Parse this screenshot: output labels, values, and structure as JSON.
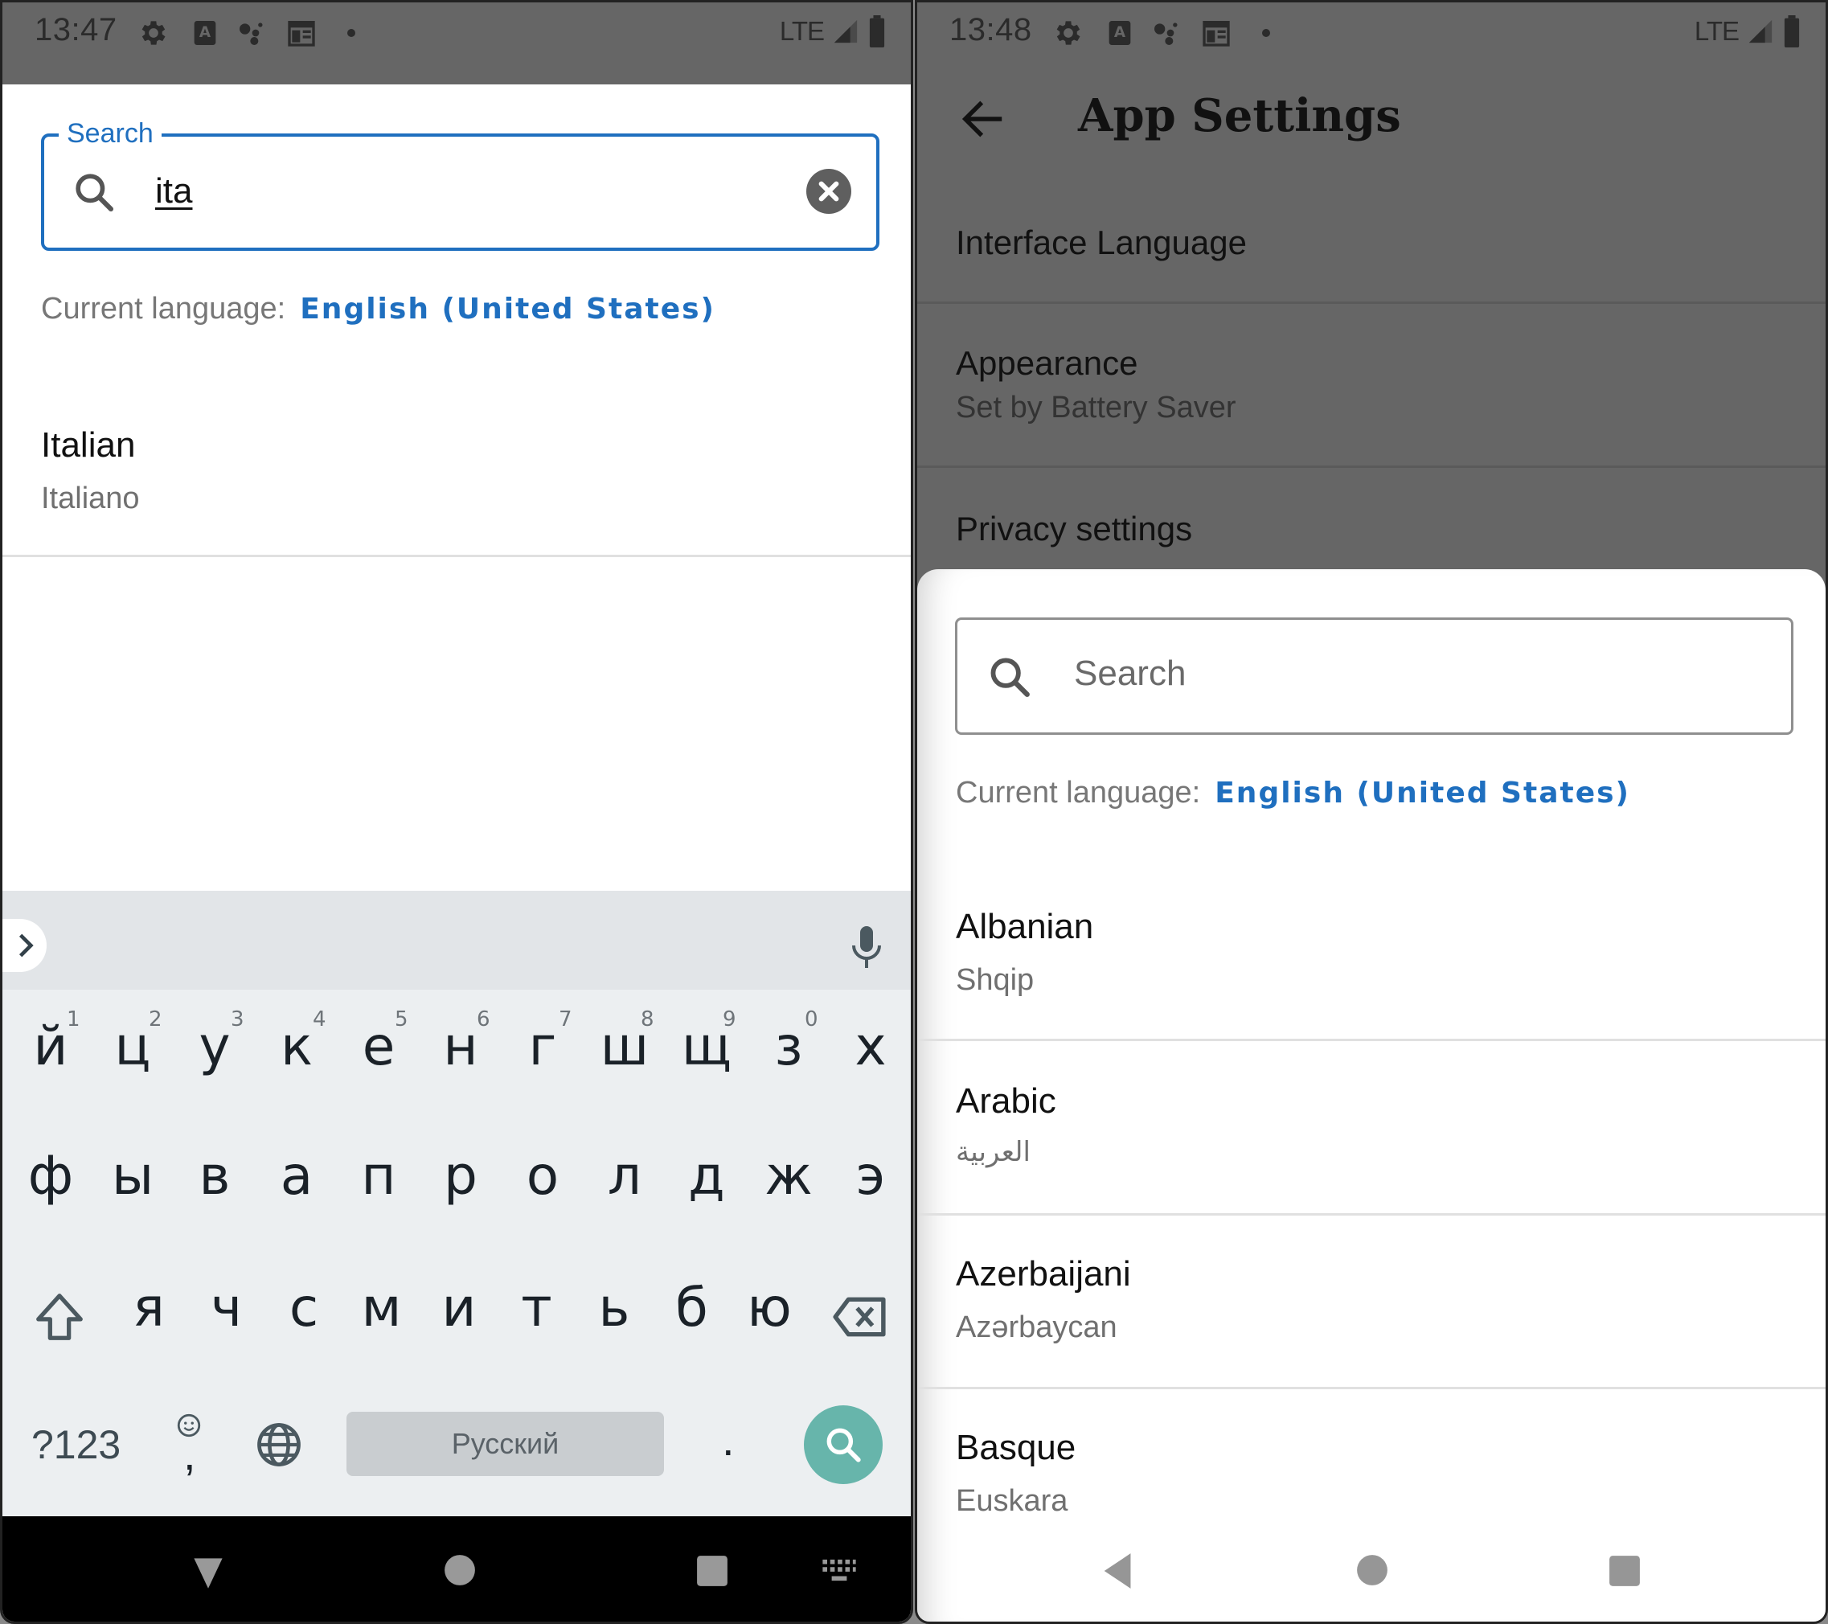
{
  "left_screen": {
    "status_bar": {
      "time": "13:47",
      "icons": [
        "gear-icon",
        "font-a-icon",
        "assistant-icon",
        "calendar-icon",
        "dot-icon"
      ],
      "network": "LTE",
      "signal": "signal-icon",
      "battery": "battery-icon"
    },
    "search": {
      "label": "Search",
      "value": "ita",
      "clear_icon": "clear-icon"
    },
    "current_language": {
      "label": "Current language:",
      "value": "English (United States)"
    },
    "results": [
      {
        "name": "Italian",
        "native": "Italiano"
      }
    ],
    "keyboard": {
      "row1": [
        "й",
        "ц",
        "у",
        "к",
        "е",
        "н",
        "г",
        "ш",
        "щ",
        "з",
        "х"
      ],
      "row1_hints": [
        "1",
        "2",
        "3",
        "4",
        "5",
        "6",
        "7",
        "8",
        "9",
        "0"
      ],
      "row2": [
        "ф",
        "ы",
        "в",
        "а",
        "п",
        "р",
        "о",
        "л",
        "д",
        "ж",
        "э"
      ],
      "row3": [
        "я",
        "ч",
        "с",
        "м",
        "и",
        "т",
        "ь",
        "б",
        "ю"
      ],
      "symbols_key": "?123",
      "comma_key": ",",
      "period_key": ".",
      "space_label": "Русский",
      "action_color": "#67b5ab"
    },
    "nav": [
      "back-down-icon",
      "home-icon",
      "recents-icon",
      "keyboard-switch-icon"
    ]
  },
  "right_screen": {
    "status_bar": {
      "time": "13:48",
      "icons": [
        "gear-icon",
        "font-a-icon",
        "assistant-icon",
        "calendar-icon",
        "dot-icon"
      ],
      "network": "LTE"
    },
    "app_bar": {
      "title": "App Settings"
    },
    "settings": [
      {
        "title": "Interface Language"
      },
      {
        "title": "Appearance",
        "subtitle": "Set by Battery Saver"
      },
      {
        "title": "Privacy settings"
      }
    ],
    "sheet": {
      "search_placeholder": "Search",
      "current_language": {
        "label": "Current language:",
        "value": "English (United States)"
      },
      "languages": [
        {
          "name": "Albanian",
          "native": "Shqip"
        },
        {
          "name": "Arabic",
          "native": "العربية"
        },
        {
          "name": "Azerbaijani",
          "native": "Azərbaycan"
        },
        {
          "name": "Basque",
          "native": "Euskara"
        }
      ]
    },
    "nav": [
      "back-icon",
      "home-icon",
      "recents-icon"
    ]
  },
  "colors": {
    "accent_blue": "#1f6fbf",
    "status_bar_gray": "#666666",
    "keyboard_bg": "#eceff1",
    "keyboard_action": "#67b5ab"
  }
}
